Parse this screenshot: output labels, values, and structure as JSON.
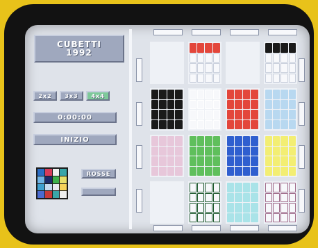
{
  "title": {
    "line1": "CUBETTI",
    "line2": "1992"
  },
  "size_buttons": [
    {
      "label": "2x2"
    },
    {
      "label": "3x3"
    },
    {
      "label": "4x4"
    }
  ],
  "timer": "0:00:00",
  "start_label": "INIZIO",
  "color_label": "ROSSE",
  "colors": {
    "background": "#e8c21a",
    "bezel": "#121212",
    "screen": "#dfe3ea",
    "plate": "#9fa8be"
  },
  "preview_colors": [
    "#2a6cc4",
    "#d63b5a",
    "#f0f0f0",
    "#3aa6a8",
    "#6fb4e6",
    "#1c2b6b",
    "#3db04b",
    "#e8e06a",
    "#3fa0d0",
    "#c5d9ef",
    "#e8e8f0",
    "#f7d35a",
    "#4b6bd1",
    "#c63a3a",
    "#3aa6a8",
    "#eeeeee"
  ],
  "board": {
    "cells": [
      {
        "color": "#ffffff",
        "pattern": "none"
      },
      {
        "color": "#e3463b",
        "pattern": "top"
      },
      {
        "color": "#ffffff",
        "pattern": "none"
      },
      {
        "color": "#ffffff",
        "pattern": "top-dark"
      },
      {
        "color": "#1a1a1a",
        "pattern": "full"
      },
      {
        "color": "#ffffff",
        "pattern": "outline"
      },
      {
        "color": "#e3463b",
        "pattern": "full"
      },
      {
        "color": "#b8d8f0",
        "pattern": "full"
      },
      {
        "color": "#e7c7da",
        "pattern": "full"
      },
      {
        "color": "#5fbf5c",
        "pattern": "full"
      },
      {
        "color": "#2f5fcf",
        "pattern": "full"
      },
      {
        "color": "#f3ee73",
        "pattern": "full"
      },
      {
        "color": "#ffffff",
        "pattern": "none"
      },
      {
        "color": "#1f5a2e",
        "pattern": "outline"
      },
      {
        "color": "#a9e3e8",
        "pattern": "full"
      },
      {
        "color": "#a06a8a",
        "pattern": "outline"
      },
      {
        "color": "#bfeaa6",
        "pattern": "full"
      },
      {
        "color": "#ef9fc0",
        "pattern": "full"
      },
      {
        "color": "#8ec3f4",
        "pattern": "full"
      },
      {
        "color": "#3a64d8",
        "pattern": "full"
      }
    ]
  }
}
